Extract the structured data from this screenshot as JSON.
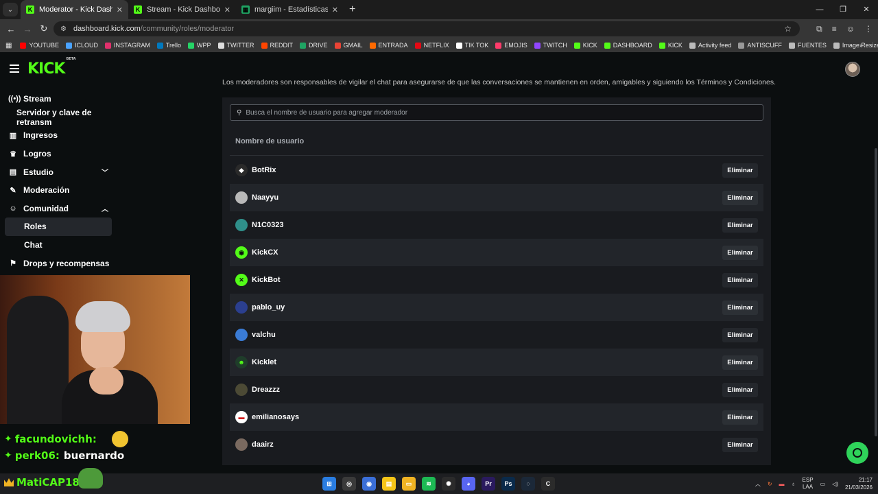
{
  "browser": {
    "tabs": [
      {
        "title": "Moderator - Kick Dashboard",
        "active": true,
        "favicon_color": "#53fc18",
        "favicon_letter": "K"
      },
      {
        "title": "Stream - Kick Dashboard",
        "active": false,
        "favicon_color": "#53fc18",
        "favicon_letter": "K"
      },
      {
        "title": "margiim - Estadísticas de Kick",
        "active": false,
        "favicon_color": "#1fa463",
        "favicon_letter": "▦"
      }
    ],
    "new_tab": "+",
    "url_host": "dashboard.kick.com",
    "url_path": "/community/roles/moderator",
    "bookmarks": [
      {
        "label": "YOUTUBE",
        "color": "#ff0000"
      },
      {
        "label": "ICLOUD",
        "color": "#4aa3ff"
      },
      {
        "label": "INSTAGRAM",
        "color": "#e1306c"
      },
      {
        "label": "Trello",
        "color": "#0079bf"
      },
      {
        "label": "WPP",
        "color": "#25d366"
      },
      {
        "label": "TWITTER",
        "color": "#dddddd"
      },
      {
        "label": "REDDIT",
        "color": "#ff4500"
      },
      {
        "label": "DRIVE",
        "color": "#1fa463"
      },
      {
        "label": "GMAIL",
        "color": "#ea4335"
      },
      {
        "label": "ENTRADA",
        "color": "#ff6a00"
      },
      {
        "label": "NETFLIX",
        "color": "#e50914"
      },
      {
        "label": "TIK TOK",
        "color": "#ffffff"
      },
      {
        "label": "EMOJIS",
        "color": "#ff3b6b"
      },
      {
        "label": "TWITCH",
        "color": "#9146ff"
      },
      {
        "label": "KICK",
        "color": "#53fc18"
      },
      {
        "label": "DASHBOARD",
        "color": "#53fc18"
      },
      {
        "label": "KICK",
        "color": "#53fc18"
      },
      {
        "label": "Activity feed",
        "color": "#bbbbbb"
      },
      {
        "label": "ANTISCUFF",
        "color": "#999999"
      },
      {
        "label": "FUENTES",
        "color": "#bbbbbb"
      },
      {
        "label": "Image Resizer | Resi...",
        "color": "#bbbbbb"
      }
    ]
  },
  "kick": {
    "logo": "KICK",
    "logo_badge": "BETA",
    "accent": "#53fc18"
  },
  "sidebar": {
    "items": [
      {
        "label": "Stream",
        "icon": "broadcast-icon",
        "glyph": "((•))",
        "kind": "main"
      },
      {
        "label": "Servidor y clave de retransm",
        "icon": "",
        "glyph": "",
        "kind": "plain"
      },
      {
        "label": "Ingresos",
        "icon": "chart-icon",
        "glyph": "▥",
        "kind": "main"
      },
      {
        "label": "Logros",
        "icon": "trophy-icon",
        "glyph": "♛",
        "kind": "main"
      },
      {
        "label": "Estudio",
        "icon": "studio-icon",
        "glyph": "▤",
        "kind": "main",
        "chevron": "﹀"
      },
      {
        "label": "Moderación",
        "icon": "wrench-icon",
        "glyph": "✎",
        "kind": "main"
      },
      {
        "label": "Comunidad",
        "icon": "community-icon",
        "glyph": "☺",
        "kind": "main",
        "chevron": "︿"
      },
      {
        "label": "Roles",
        "icon": "",
        "glyph": "",
        "kind": "selected"
      },
      {
        "label": "Chat",
        "icon": "",
        "glyph": "",
        "kind": "sub"
      },
      {
        "label": "Drops y recompensas",
        "icon": "gift-icon",
        "glyph": "⚑",
        "kind": "main"
      }
    ]
  },
  "main": {
    "description": "Los moderadores son responsables de vigilar el chat para asegurarse de que las conversaciones se mantienen en orden, amigables y siguiendo los Términos y Condiciones.",
    "search_placeholder": "Busca el nombre de usuario para agregar moderador",
    "column_header": "Nombre de usuario",
    "remove_label": "Eliminar",
    "moderators": [
      {
        "name": "BotRix",
        "avatar_color": "#2a2a2a",
        "avatar_glyph": "◆",
        "glyph_color": "#ffffff"
      },
      {
        "name": "Naayyu",
        "avatar_color": "#b9b9b9",
        "avatar_glyph": "",
        "glyph_color": "#ffffff"
      },
      {
        "name": "N1C0323",
        "avatar_color": "#2f8f8a",
        "avatar_glyph": "",
        "glyph_color": "#ffffff"
      },
      {
        "name": "KickCX",
        "avatar_color": "#53fc18",
        "avatar_glyph": "◉",
        "glyph_color": "#0b0e0f"
      },
      {
        "name": "KickBot",
        "avatar_color": "#53fc18",
        "avatar_glyph": "✕",
        "glyph_color": "#0b0e0f"
      },
      {
        "name": "pablo_uy",
        "avatar_color": "#2b3f8f",
        "avatar_glyph": "",
        "glyph_color": "#ffffff"
      },
      {
        "name": "valchu",
        "avatar_color": "#3a7bd5",
        "avatar_glyph": "",
        "glyph_color": "#ffffff"
      },
      {
        "name": "Kicklet",
        "avatar_color": "#1f3d2a",
        "avatar_glyph": "☻",
        "glyph_color": "#53fc18"
      },
      {
        "name": "Dreazzz",
        "avatar_color": "#4c4a35",
        "avatar_glyph": "",
        "glyph_color": "#ffffff"
      },
      {
        "name": "emilianosays",
        "avatar_color": "#ffffff",
        "avatar_glyph": "▬",
        "glyph_color": "#d11a1a"
      },
      {
        "name": "daairz",
        "avatar_color": "#7a6a60",
        "avatar_glyph": "",
        "glyph_color": "#ffffff"
      }
    ]
  },
  "overlay": {
    "chat": [
      {
        "user": "facundovichh:",
        "message": ""
      },
      {
        "user": "perk06:",
        "message": "buernardo"
      }
    ],
    "taskbar_user": "MatiCAP18:"
  },
  "taskbar": {
    "apps": [
      {
        "name": "start-icon",
        "color": "#2a7de1",
        "glyph": "⊞"
      },
      {
        "name": "app-icon",
        "color": "#3a3a3a",
        "glyph": "◎"
      },
      {
        "name": "chrome-icon",
        "color": "#3b6fd8",
        "glyph": "◉"
      },
      {
        "name": "notes-icon",
        "color": "#f5c518",
        "glyph": "▤"
      },
      {
        "name": "folder-icon",
        "color": "#f0b323",
        "glyph": "▭"
      },
      {
        "name": "spotify-icon",
        "color": "#1db954",
        "glyph": "≋"
      },
      {
        "name": "chatgpt-icon",
        "color": "#2b2b2b",
        "glyph": "✺"
      },
      {
        "name": "discord-icon",
        "color": "#5865f2",
        "glyph": "◕"
      },
      {
        "name": "premiere-icon",
        "color": "#2a1a5e",
        "glyph": "Pr"
      },
      {
        "name": "photoshop-icon",
        "color": "#0a2a4a",
        "glyph": "Ps"
      },
      {
        "name": "steam-icon",
        "color": "#1b2838",
        "glyph": "◌"
      },
      {
        "name": "capcut-icon",
        "color": "#2b2b2b",
        "glyph": "C"
      }
    ],
    "lang_top": "ESP",
    "lang_bottom": "LAA",
    "time": "21:17",
    "date": "21/03/2026"
  }
}
